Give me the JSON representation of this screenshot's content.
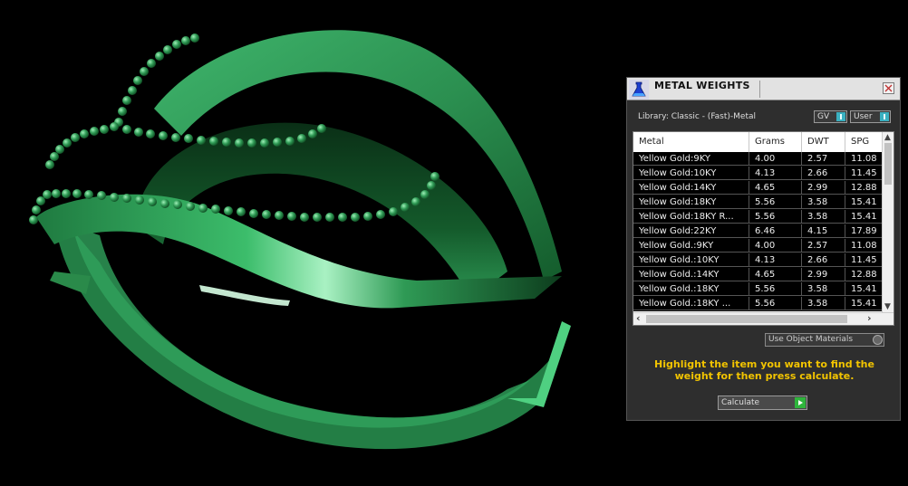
{
  "panel": {
    "title": "METAL WEIGHTS",
    "library_label": "Library: Classic - (Fast)-Metal",
    "toggle_gv": "GV",
    "toggle_user": "User",
    "columns": [
      "Metal",
      "Grams",
      "DWT",
      "SPG"
    ],
    "rows": [
      [
        "Yellow Gold:9KY",
        "4.00",
        "2.57",
        "11.08"
      ],
      [
        "Yellow Gold:10KY",
        "4.13",
        "2.66",
        "11.45"
      ],
      [
        "Yellow Gold:14KY",
        "4.65",
        "2.99",
        "12.88"
      ],
      [
        "Yellow Gold:18KY",
        "5.56",
        "3.58",
        "15.41"
      ],
      [
        "Yellow Gold:18KY R...",
        "5.56",
        "3.58",
        "15.41"
      ],
      [
        "Yellow Gold:22KY",
        "6.46",
        "4.15",
        "17.89"
      ],
      [
        "Yellow Gold.:9KY",
        "4.00",
        "2.57",
        "11.08"
      ],
      [
        "Yellow Gold.:10KY",
        "4.13",
        "2.66",
        "11.45"
      ],
      [
        "Yellow Gold.:14KY",
        "4.65",
        "2.99",
        "12.88"
      ],
      [
        "Yellow Gold.:18KY",
        "5.56",
        "3.58",
        "15.41"
      ],
      [
        "Yellow Gold.:18KY ...",
        "5.56",
        "3.58",
        "15.41"
      ]
    ],
    "materials_dropdown": "Use Object Materials",
    "help_text": "Highlight the item you want to find the weight for then press calculate.",
    "calculate_label": "Calculate"
  },
  "icons": {
    "app": "flask-icon",
    "close": "close-icon",
    "calculate": "play-arrow-icon",
    "scroll_left": "chevron-left-icon",
    "scroll_right": "chevron-right-icon",
    "scroll_up": "chevron-up-icon",
    "scroll_down": "chevron-down-icon"
  },
  "colors": {
    "model": "#2f9a55",
    "help_text": "#f2c400",
    "row_background": "#000000",
    "toggle_knob": "#3ab0c0",
    "calculate_go": "#2fb53c"
  }
}
